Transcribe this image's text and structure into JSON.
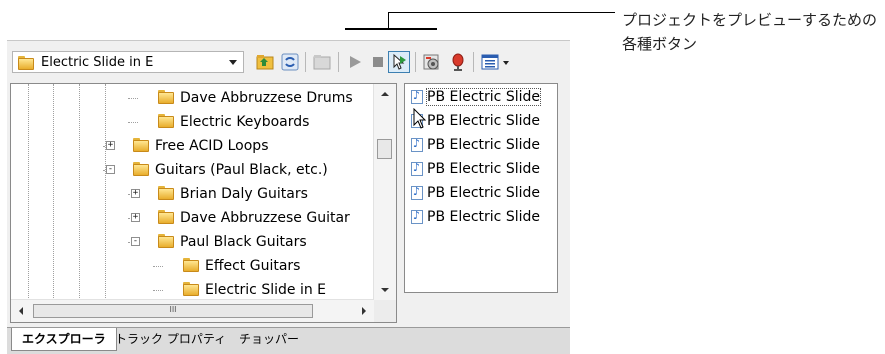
{
  "callout": {
    "text": "プロジェクトをプレビューするための各種ボタン"
  },
  "toolbar": {
    "folder_select_value": "Electric Slide in E",
    "buttons": [
      {
        "name": "up-folder-icon"
      },
      {
        "name": "refresh-icon"
      },
      {
        "name": "views-icon"
      },
      {
        "name": "play-icon"
      },
      {
        "name": "stop-icon"
      },
      {
        "name": "auto-preview-icon",
        "pressed": true
      },
      {
        "name": "favorites-icon"
      },
      {
        "name": "record-icon"
      },
      {
        "name": "view-mode-icon"
      }
    ]
  },
  "tree": {
    "items": [
      {
        "label": "Dave Abbruzzese Drums",
        "expander": ""
      },
      {
        "label": "Electric Keyboards",
        "expander": ""
      },
      {
        "label": "Free ACID Loops",
        "expander": "+"
      },
      {
        "label": "Guitars (Paul Black, etc.)",
        "expander": "-"
      },
      {
        "label": "Brian Daly Guitars",
        "expander": "+"
      },
      {
        "label": "Dave Abbruzzese Guitar",
        "expander": "+"
      },
      {
        "label": "Paul Black Guitars",
        "expander": "-"
      },
      {
        "label": "Effect Guitars",
        "expander": ""
      },
      {
        "label": "Electric Slide in E",
        "expander": ""
      }
    ],
    "hscroll_grip": "III"
  },
  "files": {
    "items": [
      {
        "label": "PB Electric Slide",
        "selected": true
      },
      {
        "label": "PB Electric Slide",
        "selected": false
      },
      {
        "label": "PB Electric Slide",
        "selected": false
      },
      {
        "label": "PB Electric Slide",
        "selected": false
      },
      {
        "label": "PB Electric Slide",
        "selected": false
      },
      {
        "label": "PB Electric Slide",
        "selected": false
      }
    ]
  },
  "tabs": [
    {
      "label": "エクスプローラ",
      "active": true
    },
    {
      "label": "トラック プロパティ",
      "active": false
    },
    {
      "label": "チョッパー",
      "active": false
    }
  ],
  "colors": {
    "accent": "#1e63c4",
    "folder": "#f0c040",
    "record": "#d93a2b"
  }
}
